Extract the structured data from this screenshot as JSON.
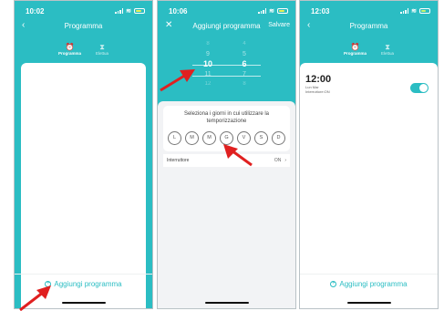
{
  "screens": [
    {
      "status_time": "10:02",
      "title": "Programma",
      "tabs": [
        "Programma",
        "Elettua"
      ],
      "add_label": "Aggiungi programma"
    },
    {
      "status_time": "10:06",
      "title": "Aggiungi programma",
      "save_label": "Salvare",
      "picker_hours": [
        "8",
        "9",
        "10",
        "11",
        "12"
      ],
      "picker_minutes": [
        "4",
        "5",
        "6",
        "7",
        "8"
      ],
      "days_title": "Seleziona i giorni in cui utilizzare la temporizzazione",
      "days": [
        "L",
        "M",
        "M",
        "G",
        "V",
        "S",
        "D"
      ],
      "switch_label": "Interruttore",
      "switch_value": "ON"
    },
    {
      "status_time": "12:03",
      "title": "Programma",
      "tabs": [
        "Programma",
        "Elettua"
      ],
      "schedule": {
        "time": "12:00",
        "days": "Lun Mar",
        "action": "Interruttore:ON"
      },
      "add_label": "Aggiungi programma"
    }
  ],
  "colors": {
    "accent": "#2bbdc3",
    "arrow": "#e02020"
  }
}
